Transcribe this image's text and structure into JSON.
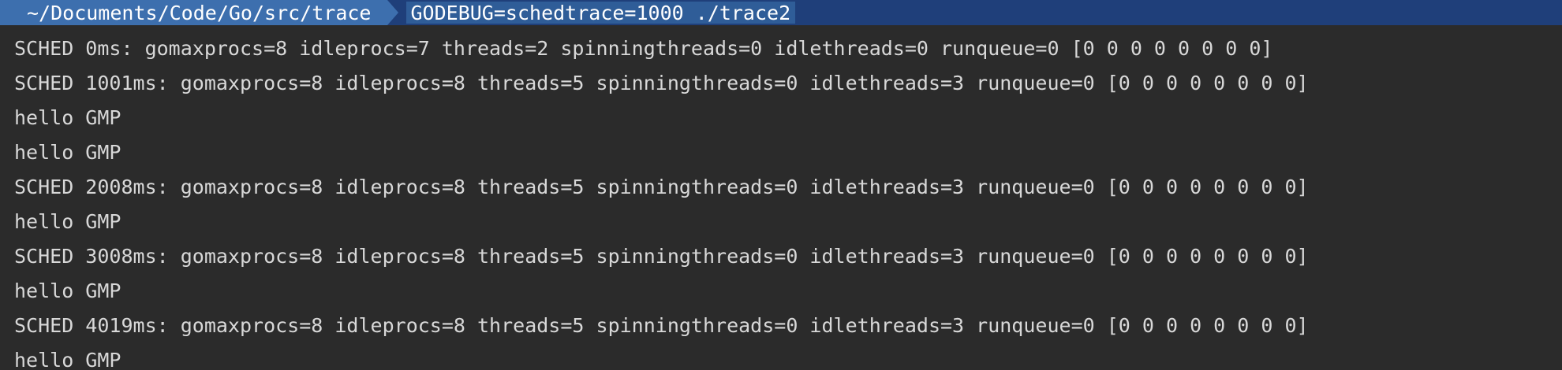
{
  "prompt": {
    "directory": "~/Documents/Code/Go/src/trace",
    "command": "GODEBUG=schedtrace=1000 ./trace2"
  },
  "output": [
    "SCHED 0ms: gomaxprocs=8 idleprocs=7 threads=2 spinningthreads=0 idlethreads=0 runqueue=0 [0 0 0 0 0 0 0 0]",
    "SCHED 1001ms: gomaxprocs=8 idleprocs=8 threads=5 spinningthreads=0 idlethreads=3 runqueue=0 [0 0 0 0 0 0 0 0]",
    "hello GMP",
    "hello GMP",
    "SCHED 2008ms: gomaxprocs=8 idleprocs=8 threads=5 spinningthreads=0 idlethreads=3 runqueue=0 [0 0 0 0 0 0 0 0]",
    "hello GMP",
    "SCHED 3008ms: gomaxprocs=8 idleprocs=8 threads=5 spinningthreads=0 idlethreads=3 runqueue=0 [0 0 0 0 0 0 0 0]",
    "hello GMP",
    "SCHED 4019ms: gomaxprocs=8 idleprocs=8 threads=5 spinningthreads=0 idlethreads=3 runqueue=0 [0 0 0 0 0 0 0 0]",
    "hello GMP"
  ]
}
